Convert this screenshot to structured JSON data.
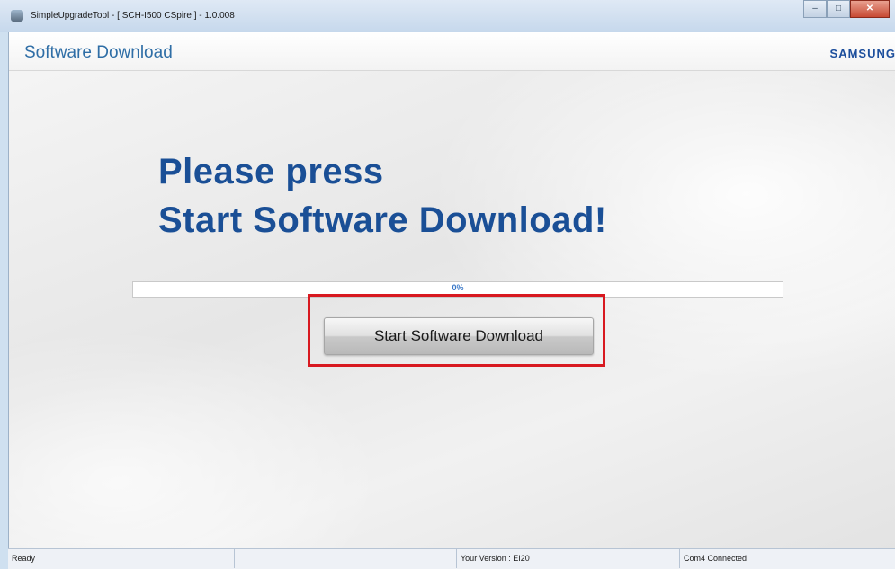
{
  "window": {
    "title": "SimpleUpgradeTool - [ SCH-I500 CSpire ] - 1.0.008",
    "caption_buttons": {
      "minimize": "–",
      "maximize": "□",
      "close": "✕"
    }
  },
  "header": {
    "title": "Software Download",
    "brand": "SAMSUNG"
  },
  "main": {
    "headline_line1": "Please press",
    "headline_line2": "Start Software Download!",
    "progress": {
      "value": 0,
      "label": "0%"
    },
    "start_button_label": "Start Software Download"
  },
  "statusbar": {
    "status": "Ready",
    "empty": "",
    "version": "Your Version : EI20",
    "connection": "Com4 Connected"
  },
  "colors": {
    "headline": "#1a4f96",
    "header_title": "#2f6ea6",
    "highlight_border": "#d81920",
    "brand": "#1c4e9c"
  },
  "icons": {
    "app": "app-icon"
  }
}
